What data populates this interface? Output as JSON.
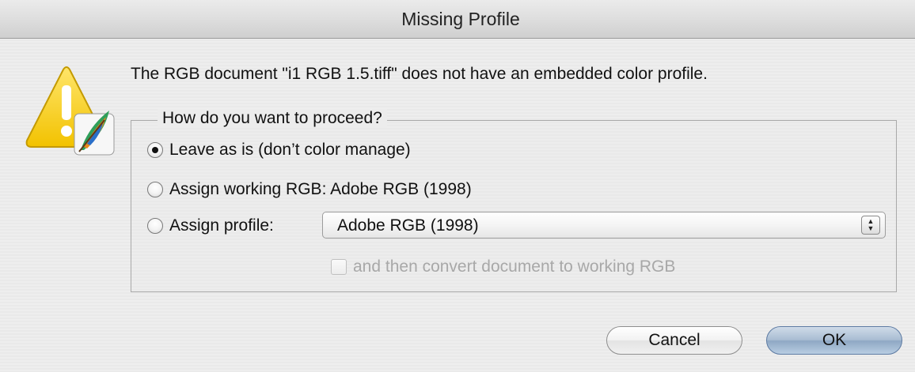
{
  "dialog": {
    "title": "Missing Profile",
    "message": "The RGB document \"i1 RGB 1.5.tiff\" does not have an embedded color profile.",
    "icon": "warning-icon"
  },
  "group": {
    "legend": "How do you want to proceed?",
    "options": [
      {
        "label": "Leave as is (don’t color manage)",
        "selected": true
      },
      {
        "label": "Assign working RGB:  Adobe RGB (1998)",
        "selected": false
      },
      {
        "label": "Assign profile:",
        "selected": false
      }
    ],
    "profile_select": {
      "value": "Adobe RGB (1998)"
    },
    "convert_checkbox": {
      "label": "and then convert document to working RGB",
      "checked": false,
      "enabled": false
    }
  },
  "buttons": {
    "cancel": "Cancel",
    "ok": "OK"
  },
  "colors": {
    "background": "#ececec",
    "default_button": "#a9bdd3",
    "disabled_text": "#a8a8a8"
  }
}
